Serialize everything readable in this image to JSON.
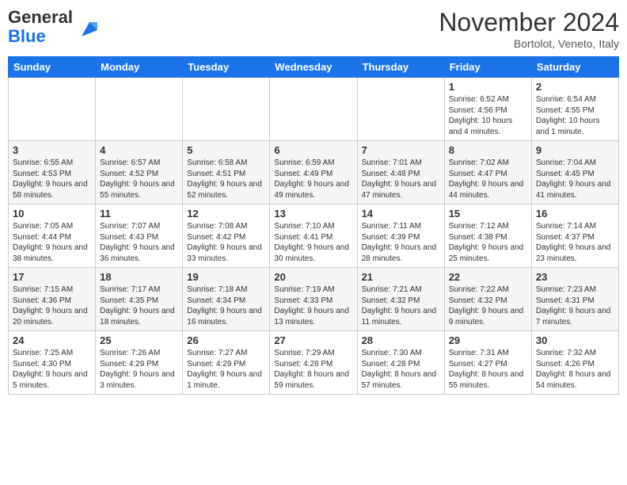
{
  "header": {
    "logo_general": "General",
    "logo_blue": "Blue",
    "month_title": "November 2024",
    "location": "Bortolot, Veneto, Italy"
  },
  "weekdays": [
    "Sunday",
    "Monday",
    "Tuesday",
    "Wednesday",
    "Thursday",
    "Friday",
    "Saturday"
  ],
  "weeks": [
    [
      {
        "day": "",
        "info": ""
      },
      {
        "day": "",
        "info": ""
      },
      {
        "day": "",
        "info": ""
      },
      {
        "day": "",
        "info": ""
      },
      {
        "day": "",
        "info": ""
      },
      {
        "day": "1",
        "info": "Sunrise: 6:52 AM\nSunset: 4:56 PM\nDaylight: 10 hours and 4 minutes."
      },
      {
        "day": "2",
        "info": "Sunrise: 6:54 AM\nSunset: 4:55 PM\nDaylight: 10 hours and 1 minute."
      }
    ],
    [
      {
        "day": "3",
        "info": "Sunrise: 6:55 AM\nSunset: 4:53 PM\nDaylight: 9 hours and 58 minutes."
      },
      {
        "day": "4",
        "info": "Sunrise: 6:57 AM\nSunset: 4:52 PM\nDaylight: 9 hours and 55 minutes."
      },
      {
        "day": "5",
        "info": "Sunrise: 6:58 AM\nSunset: 4:51 PM\nDaylight: 9 hours and 52 minutes."
      },
      {
        "day": "6",
        "info": "Sunrise: 6:59 AM\nSunset: 4:49 PM\nDaylight: 9 hours and 49 minutes."
      },
      {
        "day": "7",
        "info": "Sunrise: 7:01 AM\nSunset: 4:48 PM\nDaylight: 9 hours and 47 minutes."
      },
      {
        "day": "8",
        "info": "Sunrise: 7:02 AM\nSunset: 4:47 PM\nDaylight: 9 hours and 44 minutes."
      },
      {
        "day": "9",
        "info": "Sunrise: 7:04 AM\nSunset: 4:45 PM\nDaylight: 9 hours and 41 minutes."
      }
    ],
    [
      {
        "day": "10",
        "info": "Sunrise: 7:05 AM\nSunset: 4:44 PM\nDaylight: 9 hours and 38 minutes."
      },
      {
        "day": "11",
        "info": "Sunrise: 7:07 AM\nSunset: 4:43 PM\nDaylight: 9 hours and 36 minutes."
      },
      {
        "day": "12",
        "info": "Sunrise: 7:08 AM\nSunset: 4:42 PM\nDaylight: 9 hours and 33 minutes."
      },
      {
        "day": "13",
        "info": "Sunrise: 7:10 AM\nSunset: 4:41 PM\nDaylight: 9 hours and 30 minutes."
      },
      {
        "day": "14",
        "info": "Sunrise: 7:11 AM\nSunset: 4:39 PM\nDaylight: 9 hours and 28 minutes."
      },
      {
        "day": "15",
        "info": "Sunrise: 7:12 AM\nSunset: 4:38 PM\nDaylight: 9 hours and 25 minutes."
      },
      {
        "day": "16",
        "info": "Sunrise: 7:14 AM\nSunset: 4:37 PM\nDaylight: 9 hours and 23 minutes."
      }
    ],
    [
      {
        "day": "17",
        "info": "Sunrise: 7:15 AM\nSunset: 4:36 PM\nDaylight: 9 hours and 20 minutes."
      },
      {
        "day": "18",
        "info": "Sunrise: 7:17 AM\nSunset: 4:35 PM\nDaylight: 9 hours and 18 minutes."
      },
      {
        "day": "19",
        "info": "Sunrise: 7:18 AM\nSunset: 4:34 PM\nDaylight: 9 hours and 16 minutes."
      },
      {
        "day": "20",
        "info": "Sunrise: 7:19 AM\nSunset: 4:33 PM\nDaylight: 9 hours and 13 minutes."
      },
      {
        "day": "21",
        "info": "Sunrise: 7:21 AM\nSunset: 4:32 PM\nDaylight: 9 hours and 11 minutes."
      },
      {
        "day": "22",
        "info": "Sunrise: 7:22 AM\nSunset: 4:32 PM\nDaylight: 9 hours and 9 minutes."
      },
      {
        "day": "23",
        "info": "Sunrise: 7:23 AM\nSunset: 4:31 PM\nDaylight: 9 hours and 7 minutes."
      }
    ],
    [
      {
        "day": "24",
        "info": "Sunrise: 7:25 AM\nSunset: 4:30 PM\nDaylight: 9 hours and 5 minutes."
      },
      {
        "day": "25",
        "info": "Sunrise: 7:26 AM\nSunset: 4:29 PM\nDaylight: 9 hours and 3 minutes."
      },
      {
        "day": "26",
        "info": "Sunrise: 7:27 AM\nSunset: 4:29 PM\nDaylight: 9 hours and 1 minute."
      },
      {
        "day": "27",
        "info": "Sunrise: 7:29 AM\nSunset: 4:28 PM\nDaylight: 8 hours and 59 minutes."
      },
      {
        "day": "28",
        "info": "Sunrise: 7:30 AM\nSunset: 4:28 PM\nDaylight: 8 hours and 57 minutes."
      },
      {
        "day": "29",
        "info": "Sunrise: 7:31 AM\nSunset: 4:27 PM\nDaylight: 8 hours and 55 minutes."
      },
      {
        "day": "30",
        "info": "Sunrise: 7:32 AM\nSunset: 4:26 PM\nDaylight: 8 hours and 54 minutes."
      }
    ]
  ]
}
